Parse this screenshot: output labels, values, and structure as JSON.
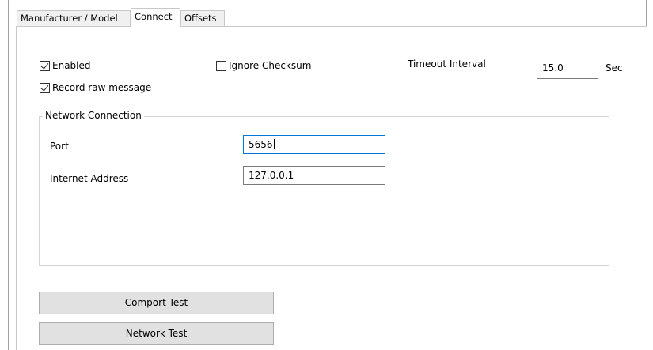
{
  "tabs": [
    {
      "label": "Manufacturer / Model",
      "selected": false
    },
    {
      "label": "Connect",
      "selected": true
    },
    {
      "label": "Offsets",
      "selected": false
    }
  ],
  "options": {
    "enabled": {
      "label": "Enabled",
      "checked": true
    },
    "record_raw": {
      "label": "Record raw message",
      "checked": true
    },
    "ignore_checksum": {
      "label": "Ignore Checksum",
      "checked": false
    }
  },
  "timeout": {
    "label": "Timeout Interval",
    "value": "15.0",
    "unit": "Sec"
  },
  "network": {
    "title": "Network Connection",
    "port_label": "Port",
    "port_value": "5656",
    "address_label": "Internet Address",
    "address_value": "127.0.0.1"
  },
  "buttons": {
    "comport_test": "Comport Test",
    "network_test": "Network Test"
  },
  "colors": {
    "focus_border": "#0078d7",
    "button_face": "#e1e1e1"
  }
}
